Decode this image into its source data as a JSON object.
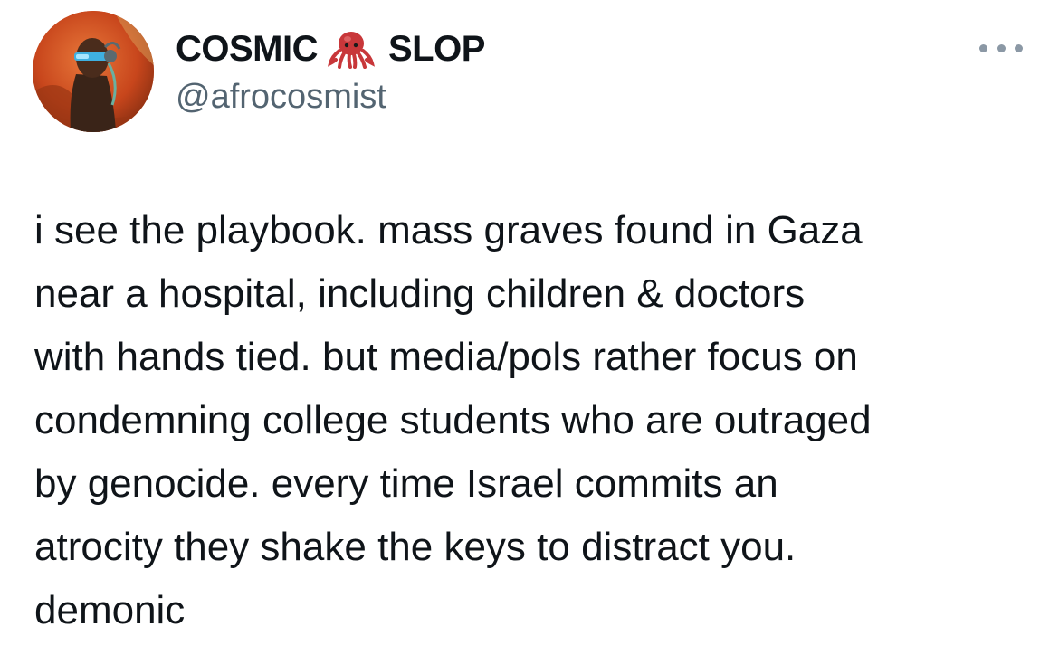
{
  "tweet": {
    "display_name_part1": "COSMIC",
    "display_name_emoji": "octopus-emoji",
    "display_name_part2": "SLOP",
    "handle": "@afrocosmist",
    "text_lines": [
      "i see the playbook. mass graves found in Gaza",
      "near a hospital, including children & doctors",
      "with hands tied. but media/pols rather focus on",
      "condemning college students who are outraged",
      "by genocide. every time Israel commits an",
      "atrocity they shake the keys to distract you.",
      "demonic"
    ]
  },
  "colors": {
    "text": "#0f1419",
    "secondary": "#536471",
    "more_dots": "#8b98a5",
    "avatar_bg": "#c84a1a"
  }
}
